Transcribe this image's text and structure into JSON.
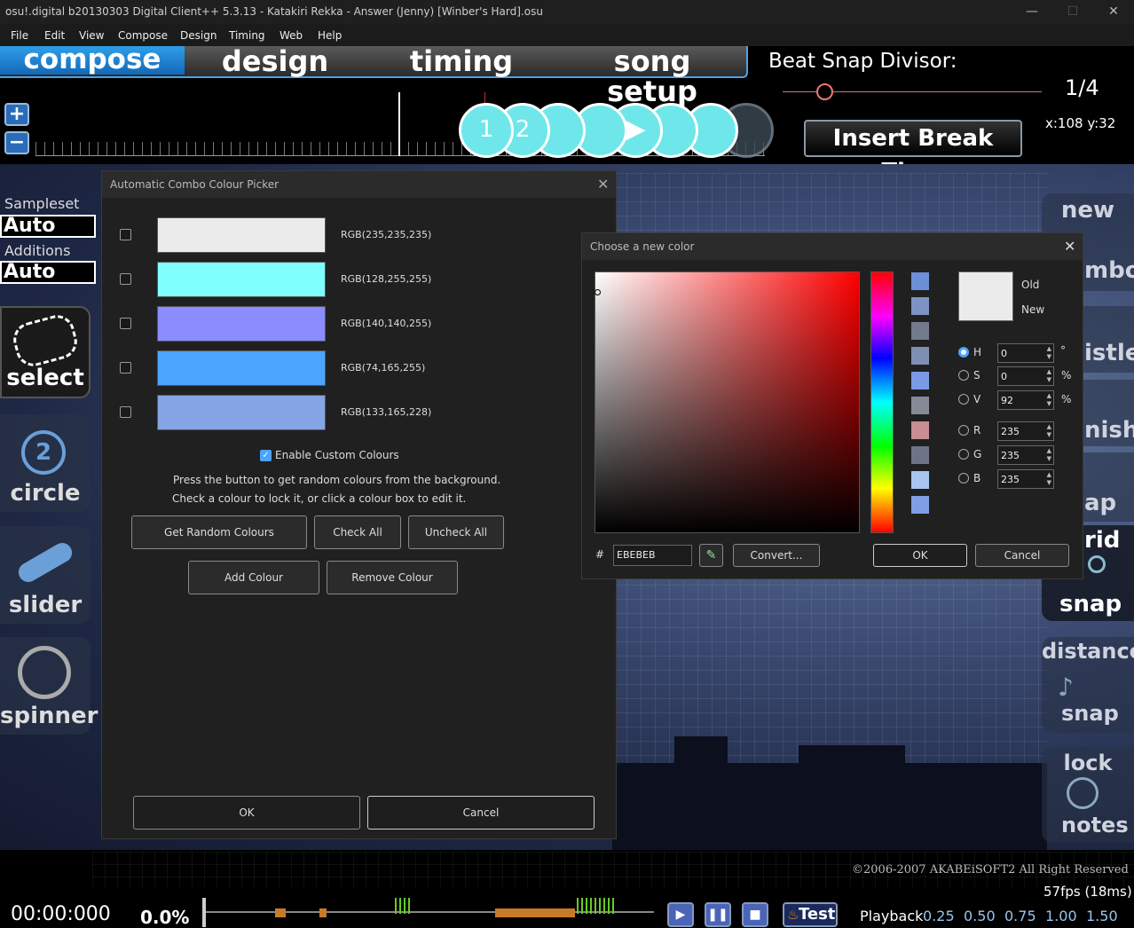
{
  "window": {
    "title": "osu!.digital b20130303 Digital Client++ 5.3.13 - Katakiri Rekka - Answer (Jenny) [Winber's Hard].osu",
    "min": "—",
    "max": "☐",
    "close": "✕"
  },
  "menu": [
    "File",
    "Edit",
    "View",
    "Compose",
    "Design",
    "Timing",
    "Web",
    "Help"
  ],
  "tabs": {
    "compose": "compose",
    "design": "design",
    "timing": "timing",
    "song_setup": "song setup"
  },
  "beat_snap": {
    "label": "Beat Snap Divisor:",
    "value": "1/4",
    "fraction": 0.16
  },
  "insert_break": "Insert Break Time",
  "coords": "x:108 y:32",
  "zoom_in": "+",
  "zoom_out": "−",
  "timeline_circles": [
    "1",
    "2"
  ],
  "left_panel": {
    "sampleset_label": "Sampleset",
    "sampleset_value": "Auto",
    "additions_label": "Additions",
    "additions_value": "Auto"
  },
  "tools": {
    "select": "select",
    "circle": "circle",
    "slider": "slider",
    "spinner": "spinner"
  },
  "right_tools": {
    "new": "new",
    "combo": "mbo",
    "whistle": "istle",
    "finish": "nish",
    "clap": "ap",
    "grid": "rid",
    "snap": "snap",
    "distance": "distance",
    "dsnap": "snap",
    "lock": "lock",
    "notes": "notes"
  },
  "combo_dialog": {
    "title": "Automatic Combo Colour Picker",
    "close": "✕",
    "colours": [
      {
        "label": "RGB(235,235,235)",
        "hex": "#ebebeb"
      },
      {
        "label": "RGB(128,255,255)",
        "hex": "#80ffff"
      },
      {
        "label": "RGB(140,140,255)",
        "hex": "#8c8cff"
      },
      {
        "label": "RGB(74,165,255)",
        "hex": "#4aa5ff"
      },
      {
        "label": "RGB(133,165,228)",
        "hex": "#85a5e4"
      }
    ],
    "enable_custom": "Enable Custom Colours",
    "help1": "Press the button to get random colours from the background.",
    "help2": "Check a colour to lock it, or click a colour box to edit it.",
    "get_random": "Get Random Colours",
    "check_all": "Check All",
    "uncheck_all": "Uncheck All",
    "add_colour": "Add Colour",
    "remove_colour": "Remove Colour",
    "ok": "OK",
    "cancel": "Cancel"
  },
  "color_dialog": {
    "title": "Choose a new color",
    "close": "✕",
    "old": "Old",
    "new": "New",
    "h_label": "H",
    "h": "0",
    "h_unit": "°",
    "s_label": "S",
    "s": "0",
    "s_unit": "%",
    "v_label": "V",
    "v": "92",
    "v_unit": "%",
    "r_label": "R",
    "r": "235",
    "g_label": "G",
    "g": "235",
    "b_label": "B",
    "b": "235",
    "hash": "#",
    "hex": "EBEBEB",
    "convert": "Convert...",
    "ok": "OK",
    "cancel": "Cancel",
    "custom": [
      "#6d8fd8",
      "#7d93c4",
      "#737a8c",
      "#7f8fb4",
      "#7b9ae6",
      "#858b96",
      "#c98d94",
      "#6e7485",
      "#a9c4ee",
      "#7f9ee6"
    ]
  },
  "status": {
    "copyright": "©2006-2007 AKABEiSOFT2 All Right Reserved",
    "fps": "57fps (18ms)",
    "time": "00:00:000",
    "percent": "0.0%",
    "test": "Test",
    "playback": "Playback",
    "speeds": [
      "0.25",
      "0.50",
      "0.75",
      "1.00",
      "1.50"
    ]
  }
}
